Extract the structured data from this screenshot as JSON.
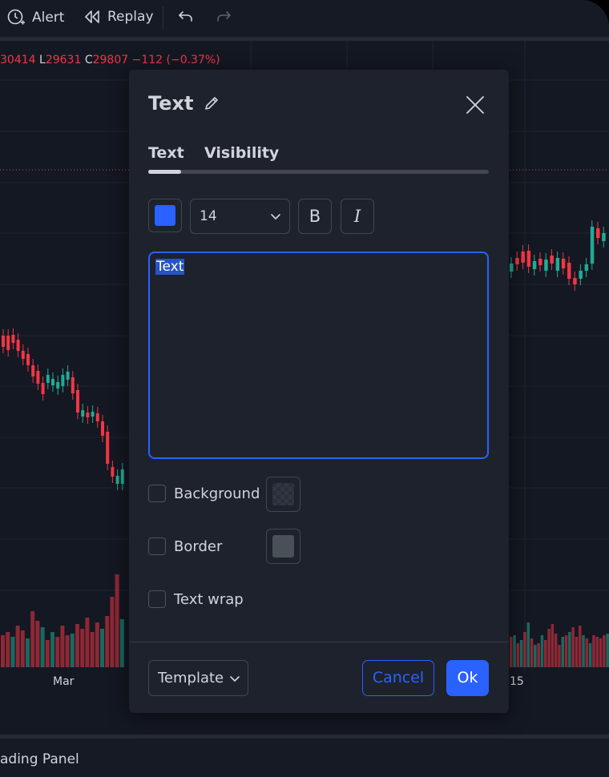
{
  "toolbar": {
    "alert_label": "Alert",
    "replay_label": "Replay"
  },
  "ohlc": {
    "open_value": "30414",
    "low_label": "L",
    "low_value": "29631",
    "close_label": "C",
    "close_value": "29807",
    "change": "−112 (−0.37%)"
  },
  "chart": {
    "x_labels": [
      "Mar",
      "15"
    ],
    "up_color": "#22ab94",
    "down_color": "#f23645"
  },
  "bottom_panel": {
    "label": "ading Panel"
  },
  "dialog": {
    "title": "Text",
    "tabs": [
      {
        "label": "Text",
        "active": true
      },
      {
        "label": "Visibility",
        "active": false
      }
    ],
    "text_color": "#2962ff",
    "font_size": "14",
    "bold_label": "B",
    "italic_label": "I",
    "text_value": "Text",
    "options": [
      {
        "label": "Background",
        "checked": false
      },
      {
        "label": "Border",
        "checked": false
      },
      {
        "label": "Text wrap",
        "checked": false
      }
    ],
    "border_color": "#4a5057",
    "template_label": "Template",
    "cancel_label": "Cancel",
    "ok_label": "Ok"
  }
}
